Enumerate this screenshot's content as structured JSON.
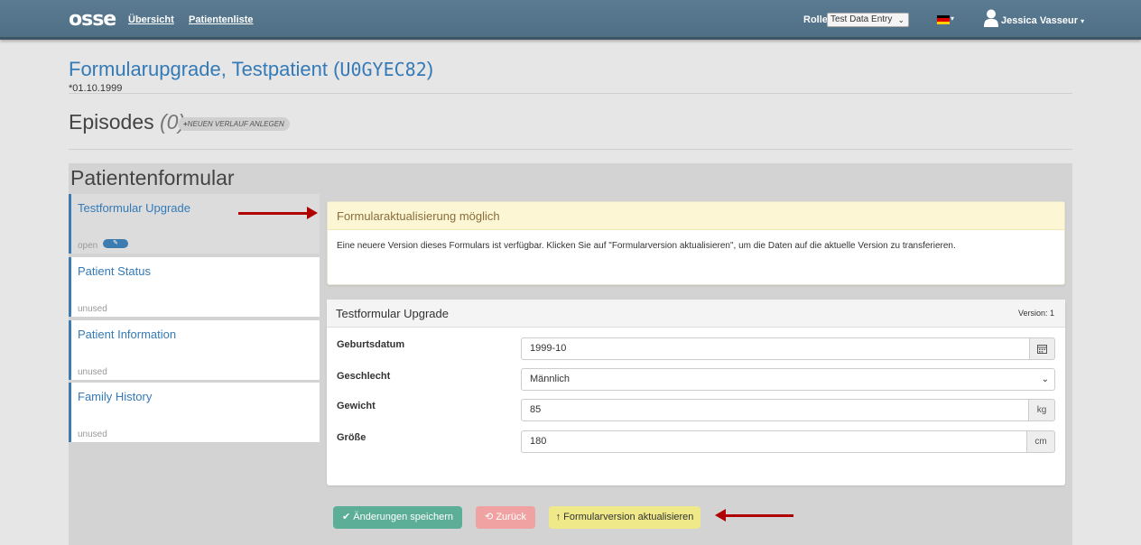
{
  "navbar": {
    "logo": "osse",
    "links": [
      "Übersicht",
      "Patientenliste"
    ],
    "role_label": "Rolle",
    "role_value": "Test Data Entry",
    "language_flag": "de-flag-icon",
    "user_name": "Jessica Vasseur"
  },
  "header": {
    "title": "Formularupgrade, Testpatient (",
    "patient_id": "U0GYEC82",
    "title_close": ")",
    "birthdate": "*01.10.1999"
  },
  "episodes": {
    "title": "Episodes",
    "count": "(0)",
    "new_button": "NEUEN VERLAUF ANLEGEN"
  },
  "patient_form": {
    "title": "Patientenformular",
    "sidebar": [
      {
        "label": "Testformular Upgrade",
        "status": "open"
      },
      {
        "label": "Patient Status",
        "status": "unused"
      },
      {
        "label": "Patient Information",
        "status": "unused"
      },
      {
        "label": "Family History",
        "status": "unused"
      }
    ]
  },
  "alert": {
    "title": "Formularaktualisierung möglich",
    "body": "Eine neuere Version dieses Formulars ist verfügbar. Klicken Sie auf \"Formularversion aktualisieren\", um die Daten auf die aktuelle Version zu transferieren."
  },
  "form": {
    "title": "Testformular Upgrade",
    "version": "Version: 1",
    "fields": [
      {
        "label": "Geburtsdatum",
        "value": "1999-10",
        "addon": "calendar-icon"
      },
      {
        "label": "Geschlecht",
        "value": "Männlich"
      },
      {
        "label": "Gewicht",
        "value": "85",
        "unit": "kg"
      },
      {
        "label": "Größe",
        "value": "180",
        "unit": "cm"
      }
    ]
  },
  "buttons": {
    "save": "Änderungen speichern",
    "back": "Zurück",
    "upgrade": "Formularversion aktualisieren"
  },
  "colors": {
    "navbar": "#54758b",
    "link": "#337ab7",
    "alert_bg": "#fcf6d5",
    "save": "#5cae96",
    "back": "#f0a2a2",
    "upgrade": "#efe98a",
    "annotation_arrow": "#b00000"
  }
}
